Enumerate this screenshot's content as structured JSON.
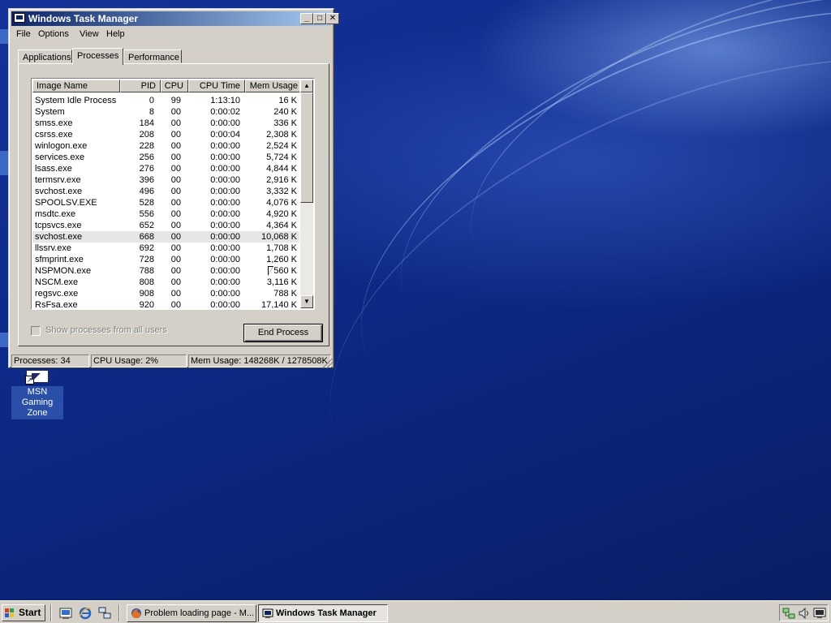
{
  "window": {
    "title": "Windows Task Manager",
    "minimize_glyph": "_",
    "maximize_glyph": "□",
    "close_glyph": "✕"
  },
  "menu": [
    "File",
    "Options",
    "View",
    "Help"
  ],
  "tabs": [
    {
      "label": "Applications",
      "active": false
    },
    {
      "label": "Processes",
      "active": true
    },
    {
      "label": "Performance",
      "active": false
    }
  ],
  "table": {
    "columns": [
      "Image Name",
      "PID",
      "CPU",
      "CPU Time",
      "Mem Usage"
    ],
    "rows": [
      [
        "System Idle Process",
        "0",
        "99",
        "1:13:10",
        "16 K"
      ],
      [
        "System",
        "8",
        "00",
        "0:00:02",
        "240 K"
      ],
      [
        "smss.exe",
        "184",
        "00",
        "0:00:00",
        "336 K"
      ],
      [
        "csrss.exe",
        "208",
        "00",
        "0:00:04",
        "2,308 K"
      ],
      [
        "winlogon.exe",
        "228",
        "00",
        "0:00:00",
        "2,524 K"
      ],
      [
        "services.exe",
        "256",
        "00",
        "0:00:00",
        "5,724 K"
      ],
      [
        "lsass.exe",
        "276",
        "00",
        "0:00:00",
        "4,844 K"
      ],
      [
        "termsrv.exe",
        "396",
        "00",
        "0:00:00",
        "2,916 K"
      ],
      [
        "svchost.exe",
        "496",
        "00",
        "0:00:00",
        "3,332 K"
      ],
      [
        "SPOOLSV.EXE",
        "528",
        "00",
        "0:00:00",
        "4,076 K"
      ],
      [
        "msdtc.exe",
        "556",
        "00",
        "0:00:00",
        "4,920 K"
      ],
      [
        "tcpsvcs.exe",
        "652",
        "00",
        "0:00:00",
        "4,364 K"
      ],
      [
        "svchost.exe",
        "668",
        "00",
        "0:00:00",
        "10,068 K"
      ],
      [
        "llssrv.exe",
        "692",
        "00",
        "0:00:00",
        "1,708 K"
      ],
      [
        "sfmprint.exe",
        "728",
        "00",
        "0:00:00",
        "1,260 K"
      ],
      [
        "NSPMON.exe",
        "788",
        "00",
        "0:00:00",
        "560 K"
      ],
      [
        "NSCM.exe",
        "808",
        "00",
        "0:00:00",
        "3,116 K"
      ],
      [
        "regsvc.exe",
        "908",
        "00",
        "0:00:00",
        "788 K"
      ],
      [
        "RsFsa.exe",
        "920",
        "00",
        "0:00:00",
        "17,140 K"
      ]
    ],
    "selected_row": 12
  },
  "show_all_users_label": "Show processes from all users",
  "end_process_label": "End Process",
  "status": {
    "processes": "Processes: 34",
    "cpu": "CPU Usage: 2%",
    "mem": "Mem Usage: 148268K / 1278508K"
  },
  "desktop_icon": {
    "label_line1": "MSN Gaming",
    "label_line2": "Zone"
  },
  "taskbar": {
    "start_label": "Start",
    "tasks": [
      {
        "label": "Problem loading page - M...",
        "icon": "firefox-icon",
        "active": false
      },
      {
        "label": "Windows Task Manager",
        "icon": "task-manager-icon",
        "active": true
      }
    ]
  },
  "colors": {
    "titlebar_start": "#0a246a",
    "titlebar_end": "#a6caf0",
    "face": "#d4d0c8",
    "desktop": "#0e2a86"
  }
}
